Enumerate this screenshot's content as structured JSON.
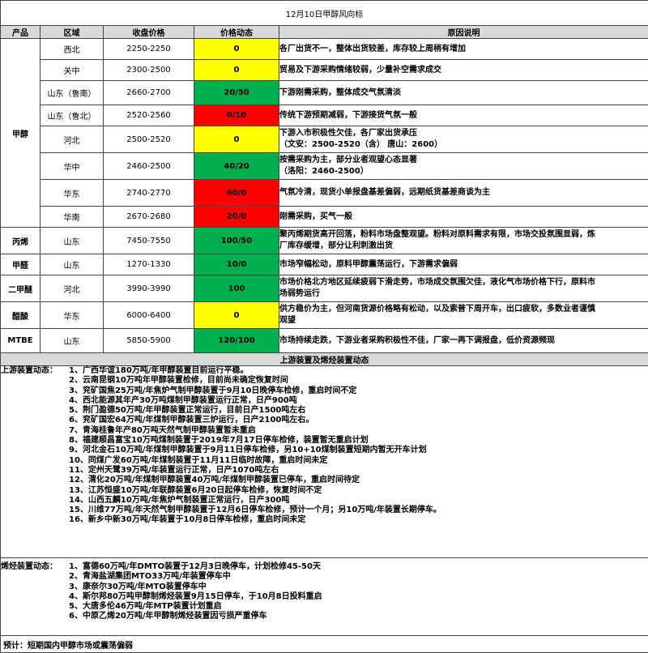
{
  "title": "12月10日甲醇风向标",
  "headers": [
    "产品",
    "区域",
    "收盘价格",
    "价格动态",
    "原因说明"
  ],
  "methanol": {
    "product": "甲醇",
    "rows": [
      {
        "region": "西北",
        "price": "2250-2250",
        "change": "0",
        "color": "yellow",
        "reason": [
          "各厂出货不一，整体出货较差，库存较上周稍有增加"
        ]
      },
      {
        "region": "关中",
        "price": "2300-2500",
        "change": "0",
        "color": "yellow",
        "reason": [
          "贸易及下游采购情绪较弱，少量补空需求成交"
        ]
      },
      {
        "region": "山东（鲁南）",
        "price": "2660-2700",
        "change": "20/50",
        "color": "green",
        "reason": [
          "下游刚需采购，整体成交气氛清淡"
        ]
      },
      {
        "region": "山东（鲁北）",
        "price": "2520-2560",
        "change": "0/10",
        "color": "red",
        "reason": [
          "传统下游预期减弱，下游接货气氛一般"
        ]
      },
      {
        "region": "河北",
        "price": "2500-2520",
        "change": "0",
        "color": "yellow",
        "reason": [
          "下游入市积极性欠佳，各厂家出货承压",
          "（文安：2500-2520（含）  唐山：2600）"
        ]
      },
      {
        "region": "华中",
        "price": "2460-2500",
        "change": "40/20",
        "color": "green",
        "reason": [
          "按需采购为主，部分业者观望心态显著",
          "（洛阳：2460-2500）"
        ]
      },
      {
        "region": "华东",
        "price": "2740-2770",
        "change": "60/0",
        "color": "red",
        "reason": [
          "气氛冷清，现货小单报盘基差偏弱，远期纸货基差商谈为主"
        ]
      },
      {
        "region": "华南",
        "price": "2670-2680",
        "change": "20/0",
        "color": "red",
        "reason": [
          "刚需采购，买气一般"
        ]
      }
    ]
  },
  "others": [
    {
      "product": "丙烯",
      "region": "山东",
      "price": "7450-7550",
      "change": "100/50",
      "color": "green",
      "reason": [
        "聚丙烯期货高开回落，粉料市场盘整观望。粉料对原料需求有限，市场交投氛围显弱，炼",
        "厂库存缓增，部分让利刺激出货"
      ]
    },
    {
      "product": "甲醛",
      "region": "山东",
      "price": "1270-1330",
      "change": "10/0",
      "color": "green",
      "reason": [
        "市场窄幅松动，原料甲醇震荡运行，下游需求偏弱"
      ]
    },
    {
      "product": "二甲醚",
      "region": "河北",
      "price": "3990-3990",
      "change": "100",
      "color": "green",
      "reason": [
        "市场价格北方地区延续疲弱下滑走势，市场成交氛围欠佳，液化气市场价格下行，原料市",
        "场弱势运行"
      ]
    },
    {
      "product": "醋酸",
      "region": "华东",
      "price": "6000-6400",
      "change": "0",
      "color": "yellow",
      "reason": [
        "供方稳价为主，但河南货源价格略有松动，以及索普下周开车，出口疲软，多数业者谨慎",
        "观望"
      ]
    },
    {
      "product": "MTBE",
      "region": "山东",
      "price": "5850-5900",
      "change": "120/100",
      "color": "green",
      "reason": [
        "市场持续走跌，下游业者采购积极性不佳，厂家一再下调报盘，低价资源频现"
      ]
    }
  ],
  "upstream_title": "上游装置及烯烃装置动态",
  "upstream": {
    "label": "上游装置动态：",
    "items": [
      "1、广西华谊180万吨/年甲醇装置目前运行平稳。",
      "2、云南昆钢10万吨年甲醇装置检修，目前尚未确定恢复时间",
      "3、兖矿国焦25万吨/年焦炉气制甲醇装置于9月10日晚停车检修，重启时间不定",
      "4、西北能源其年产30万吨煤制甲醇装置运行正常，日产900吨",
      "5、荆门盈德50万吨/年甲醇装置正常运行，目前日产1500吨左右",
      "6、兖矿国宏64万吨/年煤制甲醇装置三炉运行，日产2100吨左右。",
      "7、青海桂鲁年产80万吨天然气制甲醇装置暂未重启",
      "8、福建顺昌富宝10万吨煤制装置于2019年7月17日停车检修，装置暂无重启计划",
      "9、河北金石10万吨/年煤制甲醇装置于9月11日停车检修，另10+10煤制装置短期内暂无开车计划",
      "10、同煤广发60万吨/年煤制装置于11月11日临时故障，重启时间未定",
      "11、定州天鹭39万吨/年装置运行正常，日产1070吨左右",
      "12、渭化20万吨/年煤制甲醇装置40万吨/年煤制甲醇装置已停车，重启时间待定",
      "13、江苏恒盛10万吨/年联醇装置6月20日起停车检修，恢复时间不定",
      "14、山西五麟10万吨/年焦炉气制装置正常运行，日产300吨",
      "15、川维77万吨/年天然气制甲醇装置于12月6日停车检修，预计一个月；另10万吨/年装置长期停车。",
      "16、新乡中新30万吨/年装置于10月8日停车检修，重启时间未定"
    ]
  },
  "olefin": {
    "label": "烯烃装置动态：",
    "items": [
      "1、富德60万吨/年DMTO装置于12月3日晚停车，计划检修45-50天",
      "2、青海盐湖集团MTO33万吨/年装置停车中",
      "3、康奈尔30万吨/年MTO装置停车中",
      "4、斯尔邦80万吨甲醇制烯烃装置9月15日停车，于10月8日投料重启",
      "5、大唐多伦46万吨/年MTP装置计划重启",
      "6、中原乙烯20万吨/年甲醇制烯烃装置因亏损严重停车"
    ]
  },
  "forecast": "预计：短期国内甲醇市场或震荡偏弱"
}
